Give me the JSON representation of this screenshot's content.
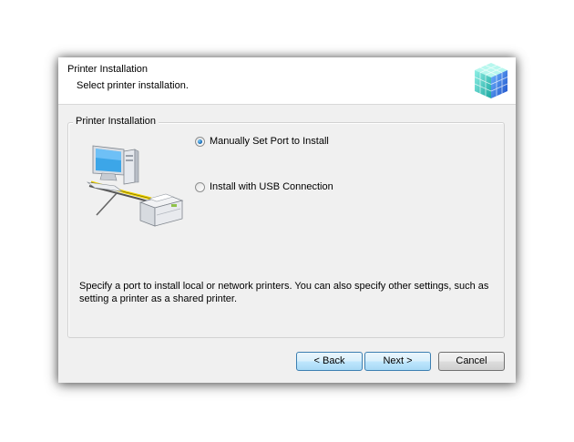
{
  "header": {
    "title": "Printer Installation",
    "subtitle": "Select printer installation.",
    "icon": "installer-cubes-icon"
  },
  "group": {
    "label": "Printer Installation",
    "illustration": "computer-printer-network-icon"
  },
  "options": [
    {
      "label": "Manually Set Port to Install",
      "checked": true
    },
    {
      "label": "Install with USB Connection",
      "checked": false
    }
  ],
  "description": "Specify a port to install local or network printers. You can also specify other settings, such as setting a printer as a shared printer.",
  "buttons": {
    "back": "< Back",
    "next": "Next >",
    "cancel": "Cancel"
  },
  "colors": {
    "dialog_background": "#f0f0f0",
    "header_background": "#ffffff",
    "focused_button": "#3c7fb1",
    "radio_selected": "#1b6fb8"
  }
}
